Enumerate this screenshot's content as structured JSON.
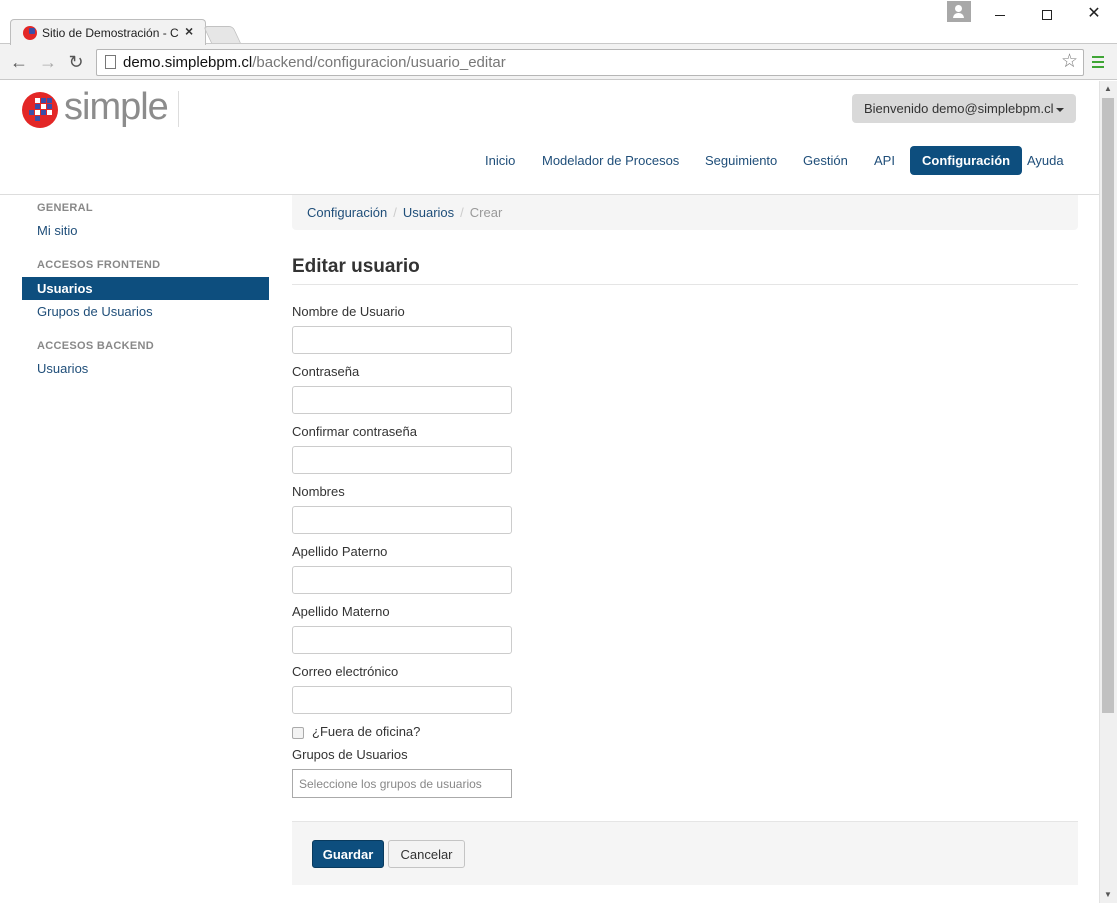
{
  "browser": {
    "tab_title": "Sitio de Demostración - C",
    "tab_close": "×",
    "url_host": "demo.simplebpm.cl",
    "url_path": "/backend/configuracion/usuario_editar",
    "back": "←",
    "forward": "→",
    "reload": "↻",
    "star": "☆",
    "window_close": "✕"
  },
  "header": {
    "logo_text": "simple",
    "user_menu": "Bienvenido demo@simplebpm.cl",
    "nav": [
      {
        "label": "Inicio"
      },
      {
        "label": "Modelador de Procesos"
      },
      {
        "label": "Seguimiento"
      },
      {
        "label": "Gestión"
      },
      {
        "label": "API"
      },
      {
        "label": "Configuración",
        "active": true
      },
      {
        "label": "Ayuda"
      }
    ]
  },
  "sidebar": {
    "sections": [
      {
        "heading": "GENERAL",
        "items": [
          {
            "label": "Mi sitio"
          }
        ]
      },
      {
        "heading": "ACCESOS FRONTEND",
        "items": [
          {
            "label": "Usuarios",
            "active": true
          },
          {
            "label": "Grupos de Usuarios"
          }
        ]
      },
      {
        "heading": "ACCESOS BACKEND",
        "items": [
          {
            "label": "Usuarios"
          }
        ]
      }
    ]
  },
  "breadcrumb": {
    "items": [
      "Configuración",
      "Usuarios"
    ],
    "current": "Crear",
    "separator": "/"
  },
  "form": {
    "title": "Editar usuario",
    "fields": [
      {
        "label": "Nombre de Usuario",
        "value": ""
      },
      {
        "label": "Contraseña",
        "value": ""
      },
      {
        "label": "Confirmar contraseña",
        "value": ""
      },
      {
        "label": "Nombres",
        "value": ""
      },
      {
        "label": "Apellido Paterno",
        "value": ""
      },
      {
        "label": "Apellido Materno",
        "value": ""
      },
      {
        "label": "Correo electrónico",
        "value": ""
      }
    ],
    "out_of_office_label": "¿Fuera de oficina?",
    "out_of_office_checked": false,
    "groups_label": "Grupos de Usuarios",
    "groups_placeholder": "Seleccione los grupos de usuarios",
    "save_label": "Guardar",
    "cancel_label": "Cancelar"
  },
  "colors": {
    "primary": "#0d4e7e",
    "link": "#1f4e79",
    "logo_red": "#e32726",
    "logo_blue": "#3b4ea8"
  }
}
